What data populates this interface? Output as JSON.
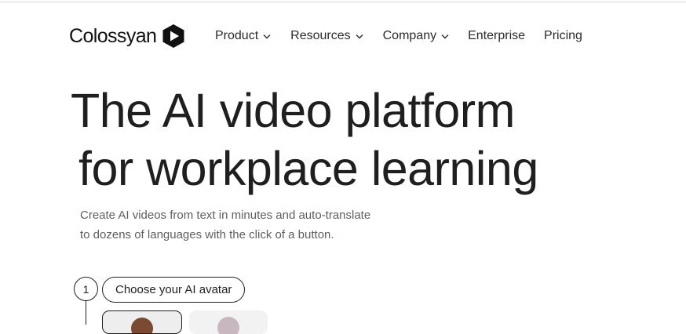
{
  "brand": {
    "name": "Colossyan"
  },
  "nav": {
    "items": [
      {
        "label": "Product",
        "has_dropdown": true
      },
      {
        "label": "Resources",
        "has_dropdown": true
      },
      {
        "label": "Company",
        "has_dropdown": true
      },
      {
        "label": "Enterprise",
        "has_dropdown": false
      },
      {
        "label": "Pricing",
        "has_dropdown": false
      }
    ]
  },
  "hero": {
    "title_line1": "The AI video platform",
    "title_line2": "for workplace learning",
    "subtitle_line1": "Create AI videos from text in minutes and auto-translate",
    "subtitle_line2": "to dozens of languages with the click of a button."
  },
  "steps": [
    {
      "number": "1",
      "label": "Choose your AI avatar"
    }
  ],
  "colors": {
    "text": "#1f1f1f",
    "muted": "#5f5f5f",
    "background": "#ffffff"
  }
}
